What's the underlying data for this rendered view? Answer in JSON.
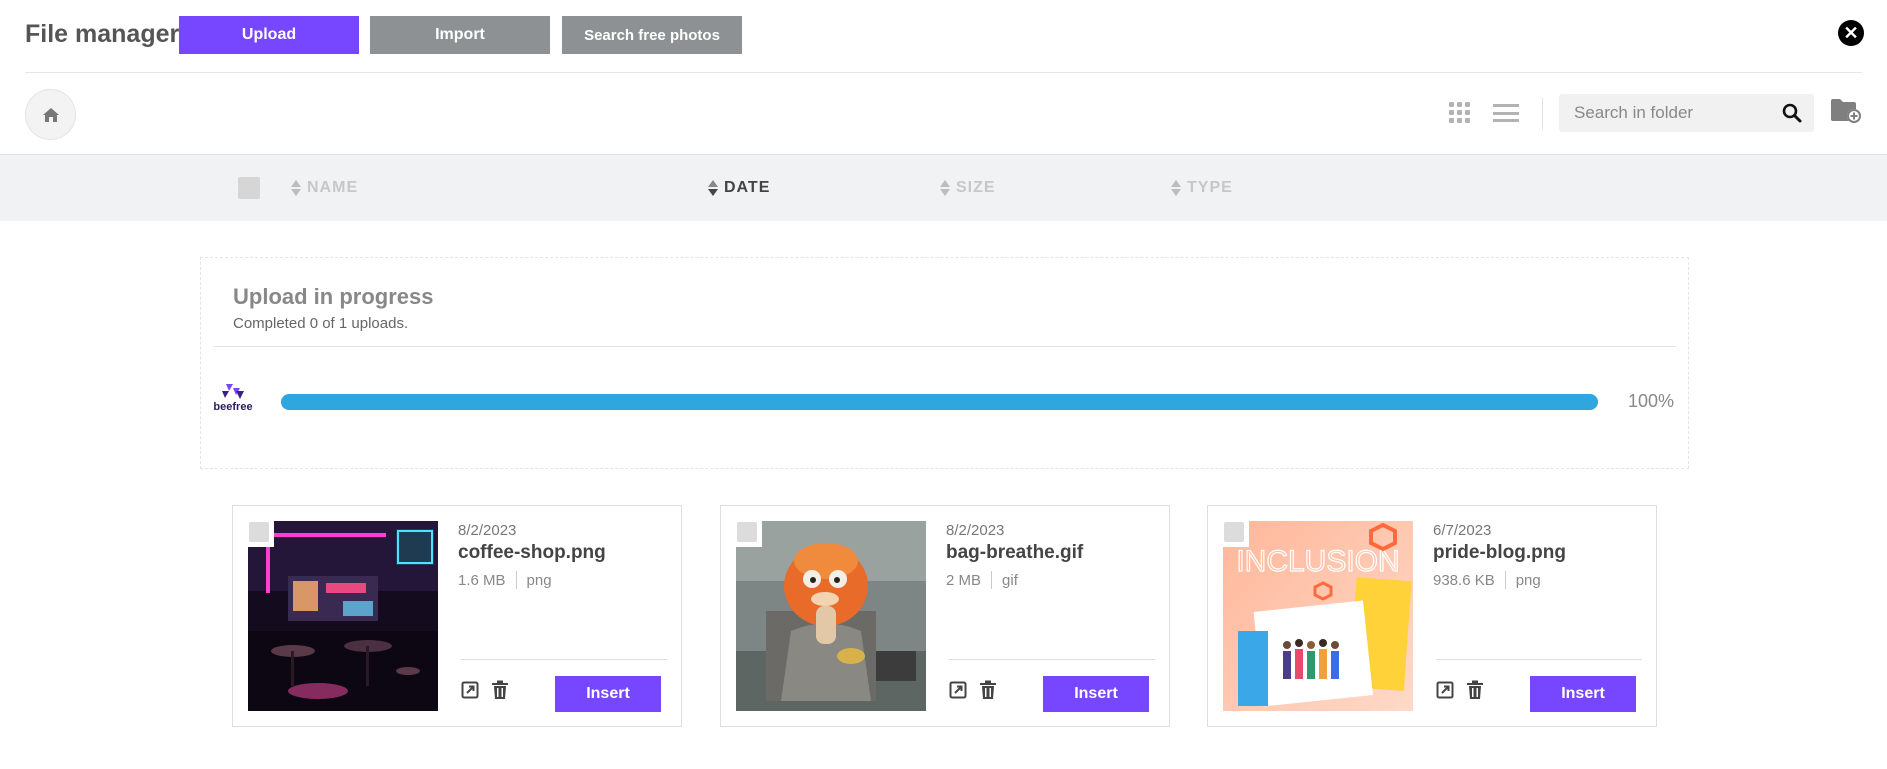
{
  "app": {
    "title": "File manager"
  },
  "toolbar": {
    "upload_label": "Upload",
    "import_label": "Import",
    "search_photos_label": "Search free photos",
    "search_placeholder": "Search in folder"
  },
  "columns": [
    {
      "label": "NAME",
      "active": false
    },
    {
      "label": "DATE",
      "active": true
    },
    {
      "label": "SIZE",
      "active": false
    },
    {
      "label": "TYPE",
      "active": false
    }
  ],
  "upload": {
    "title": "Upload in progress",
    "subtitle": "Completed 0 of 1 uploads.",
    "logo_text": "beefree",
    "progress_fraction": 1.0,
    "progress_label": "100%"
  },
  "files": [
    {
      "date": "8/2/2023",
      "name": "coffee-shop.png",
      "size": "1.6 MB",
      "type": "png",
      "insert_label": "Insert"
    },
    {
      "date": "8/2/2023",
      "name": "bag-breathe.gif",
      "size": "2 MB",
      "type": "gif",
      "insert_label": "Insert"
    },
    {
      "date": "6/7/2023",
      "name": "pride-blog.png",
      "size": "938.6 KB",
      "type": "png",
      "insert_label": "Insert"
    }
  ],
  "thumbnail_text": {
    "pride_blog_banner": "INCLUSION"
  },
  "colors": {
    "accent": "#7747ff",
    "secondary_button": "#8e9193",
    "progress": "#2fa6dd"
  },
  "icons": {
    "close": "close-icon",
    "home": "home-icon",
    "grid_view": "grid-view-icon",
    "list_view": "list-view-icon",
    "search": "search-icon",
    "new_folder": "folder-add-icon",
    "open": "open-external-icon",
    "delete": "trash-icon"
  }
}
